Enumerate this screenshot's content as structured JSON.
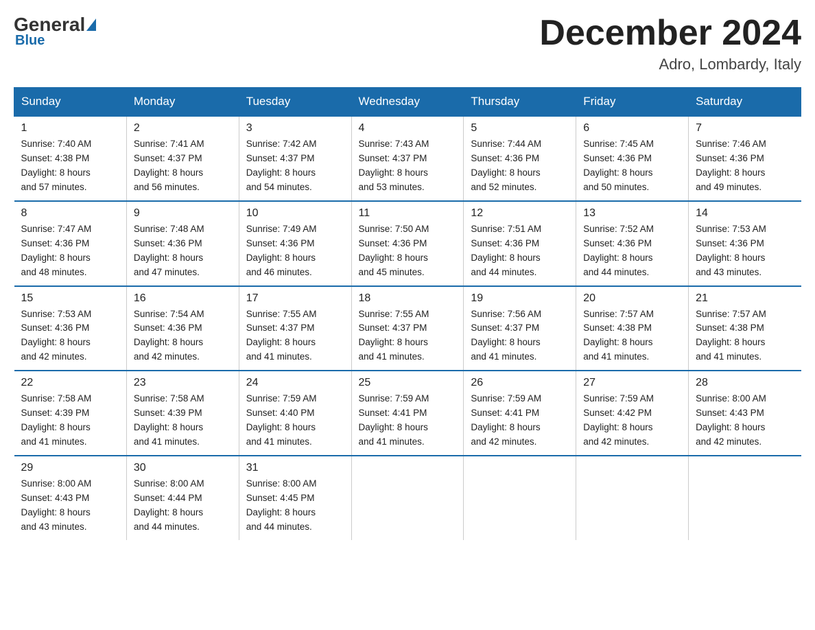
{
  "header": {
    "logo_general": "General",
    "logo_blue": "Blue",
    "month_title": "December 2024",
    "location": "Adro, Lombardy, Italy"
  },
  "days_of_week": [
    "Sunday",
    "Monday",
    "Tuesday",
    "Wednesday",
    "Thursday",
    "Friday",
    "Saturday"
  ],
  "weeks": [
    [
      {
        "day": "1",
        "sunrise": "7:40 AM",
        "sunset": "4:38 PM",
        "daylight": "8 hours and 57 minutes."
      },
      {
        "day": "2",
        "sunrise": "7:41 AM",
        "sunset": "4:37 PM",
        "daylight": "8 hours and 56 minutes."
      },
      {
        "day": "3",
        "sunrise": "7:42 AM",
        "sunset": "4:37 PM",
        "daylight": "8 hours and 54 minutes."
      },
      {
        "day": "4",
        "sunrise": "7:43 AM",
        "sunset": "4:37 PM",
        "daylight": "8 hours and 53 minutes."
      },
      {
        "day": "5",
        "sunrise": "7:44 AM",
        "sunset": "4:36 PM",
        "daylight": "8 hours and 52 minutes."
      },
      {
        "day": "6",
        "sunrise": "7:45 AM",
        "sunset": "4:36 PM",
        "daylight": "8 hours and 50 minutes."
      },
      {
        "day": "7",
        "sunrise": "7:46 AM",
        "sunset": "4:36 PM",
        "daylight": "8 hours and 49 minutes."
      }
    ],
    [
      {
        "day": "8",
        "sunrise": "7:47 AM",
        "sunset": "4:36 PM",
        "daylight": "8 hours and 48 minutes."
      },
      {
        "day": "9",
        "sunrise": "7:48 AM",
        "sunset": "4:36 PM",
        "daylight": "8 hours and 47 minutes."
      },
      {
        "day": "10",
        "sunrise": "7:49 AM",
        "sunset": "4:36 PM",
        "daylight": "8 hours and 46 minutes."
      },
      {
        "day": "11",
        "sunrise": "7:50 AM",
        "sunset": "4:36 PM",
        "daylight": "8 hours and 45 minutes."
      },
      {
        "day": "12",
        "sunrise": "7:51 AM",
        "sunset": "4:36 PM",
        "daylight": "8 hours and 44 minutes."
      },
      {
        "day": "13",
        "sunrise": "7:52 AM",
        "sunset": "4:36 PM",
        "daylight": "8 hours and 44 minutes."
      },
      {
        "day": "14",
        "sunrise": "7:53 AM",
        "sunset": "4:36 PM",
        "daylight": "8 hours and 43 minutes."
      }
    ],
    [
      {
        "day": "15",
        "sunrise": "7:53 AM",
        "sunset": "4:36 PM",
        "daylight": "8 hours and 42 minutes."
      },
      {
        "day": "16",
        "sunrise": "7:54 AM",
        "sunset": "4:36 PM",
        "daylight": "8 hours and 42 minutes."
      },
      {
        "day": "17",
        "sunrise": "7:55 AM",
        "sunset": "4:37 PM",
        "daylight": "8 hours and 41 minutes."
      },
      {
        "day": "18",
        "sunrise": "7:55 AM",
        "sunset": "4:37 PM",
        "daylight": "8 hours and 41 minutes."
      },
      {
        "day": "19",
        "sunrise": "7:56 AM",
        "sunset": "4:37 PM",
        "daylight": "8 hours and 41 minutes."
      },
      {
        "day": "20",
        "sunrise": "7:57 AM",
        "sunset": "4:38 PM",
        "daylight": "8 hours and 41 minutes."
      },
      {
        "day": "21",
        "sunrise": "7:57 AM",
        "sunset": "4:38 PM",
        "daylight": "8 hours and 41 minutes."
      }
    ],
    [
      {
        "day": "22",
        "sunrise": "7:58 AM",
        "sunset": "4:39 PM",
        "daylight": "8 hours and 41 minutes."
      },
      {
        "day": "23",
        "sunrise": "7:58 AM",
        "sunset": "4:39 PM",
        "daylight": "8 hours and 41 minutes."
      },
      {
        "day": "24",
        "sunrise": "7:59 AM",
        "sunset": "4:40 PM",
        "daylight": "8 hours and 41 minutes."
      },
      {
        "day": "25",
        "sunrise": "7:59 AM",
        "sunset": "4:41 PM",
        "daylight": "8 hours and 41 minutes."
      },
      {
        "day": "26",
        "sunrise": "7:59 AM",
        "sunset": "4:41 PM",
        "daylight": "8 hours and 42 minutes."
      },
      {
        "day": "27",
        "sunrise": "7:59 AM",
        "sunset": "4:42 PM",
        "daylight": "8 hours and 42 minutes."
      },
      {
        "day": "28",
        "sunrise": "8:00 AM",
        "sunset": "4:43 PM",
        "daylight": "8 hours and 42 minutes."
      }
    ],
    [
      {
        "day": "29",
        "sunrise": "8:00 AM",
        "sunset": "4:43 PM",
        "daylight": "8 hours and 43 minutes."
      },
      {
        "day": "30",
        "sunrise": "8:00 AM",
        "sunset": "4:44 PM",
        "daylight": "8 hours and 44 minutes."
      },
      {
        "day": "31",
        "sunrise": "8:00 AM",
        "sunset": "4:45 PM",
        "daylight": "8 hours and 44 minutes."
      },
      null,
      null,
      null,
      null
    ]
  ],
  "labels": {
    "sunrise": "Sunrise:",
    "sunset": "Sunset:",
    "daylight": "Daylight:"
  }
}
